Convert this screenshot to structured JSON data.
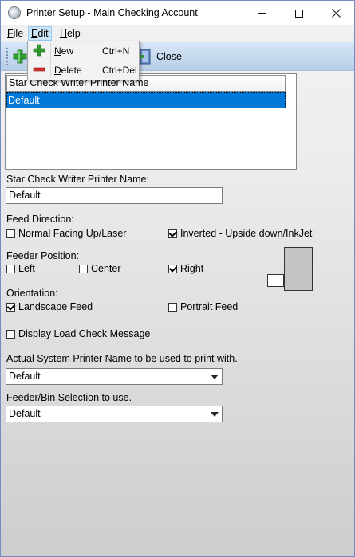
{
  "window": {
    "title": "Printer Setup - Main Checking Account",
    "controls": {
      "minimize": "minimize",
      "maximize": "maximize",
      "close": "close"
    }
  },
  "menubar": {
    "file": {
      "pre": "",
      "ul": "F",
      "post": "ile"
    },
    "edit": {
      "pre": "",
      "ul": "E",
      "post": "dit"
    },
    "help": {
      "pre": "",
      "ul": "H",
      "post": "elp"
    }
  },
  "edit_menu": {
    "new": {
      "ul": "N",
      "post": "ew",
      "shortcut": "Ctrl+N",
      "icon": "green-plus-icon"
    },
    "delete": {
      "ul": "D",
      "post": "elete",
      "shortcut": "Ctrl+Del",
      "icon": "red-minus-icon"
    }
  },
  "toolbar": {
    "add_icon": "green-plus-icon",
    "close_icon": "exit-door-icon",
    "close_label": "Close"
  },
  "printer_list": {
    "column_header": "Star Check Writer Printer Name",
    "rows": [
      "Default"
    ],
    "selected_index": 0
  },
  "form": {
    "printer_name_label": "Star Check Writer Printer Name:",
    "printer_name_value": "Default",
    "feed_direction_label": "Feed Direction:",
    "feed_normal_label": "Normal Facing Up/Laser",
    "feed_normal_checked": false,
    "feed_inverted_label": "Inverted - Upside down/InkJet",
    "feed_inverted_checked": true,
    "feeder_position_label": "Feeder Position:",
    "feeder_left_label": "Left",
    "feeder_left_checked": false,
    "feeder_center_label": "Center",
    "feeder_center_checked": false,
    "feeder_right_label": "Right",
    "feeder_right_checked": true,
    "orientation_label": "Orientation:",
    "landscape_label": "Landscape Feed",
    "landscape_checked": true,
    "portrait_label": "Portrait Feed",
    "portrait_checked": false,
    "display_load_label": "Display Load Check Message",
    "display_load_checked": false,
    "system_printer_label": "Actual System Printer Name to be used to print with.",
    "system_printer_value": "Default",
    "feeder_bin_label": "Feeder/Bin Selection to use.",
    "feeder_bin_value": "Default"
  }
}
